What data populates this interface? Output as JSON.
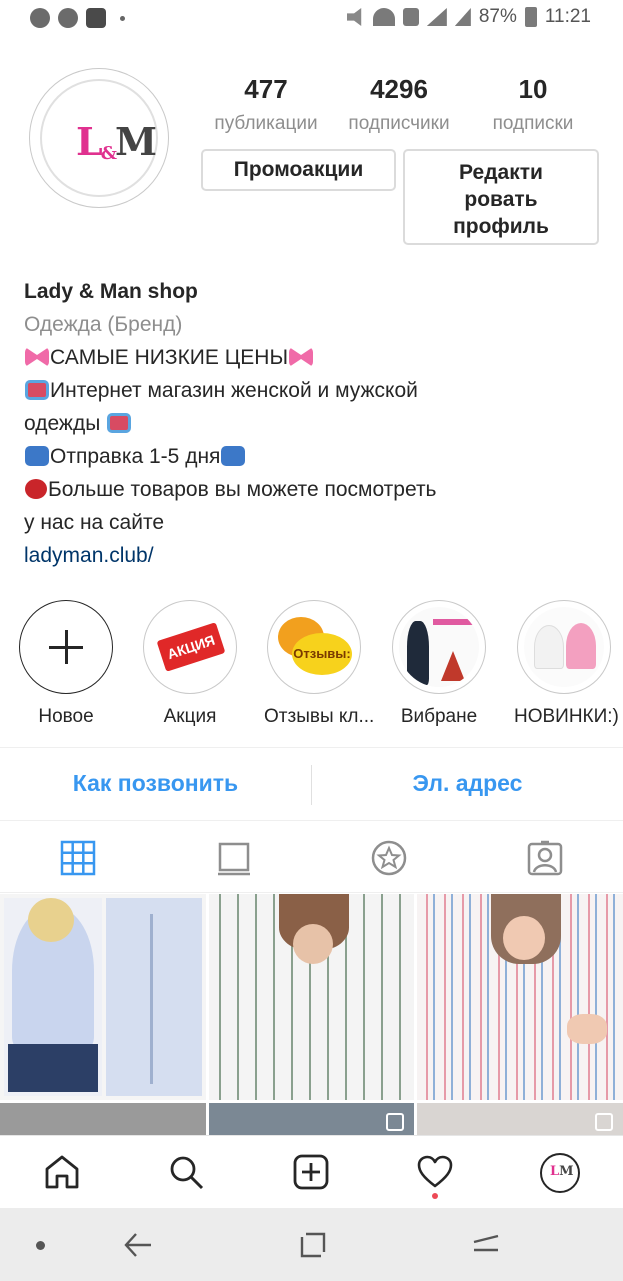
{
  "status_bar": {
    "battery": "87%",
    "time": "11:21",
    "icons": [
      "whatsapp-icon",
      "telegram-icon",
      "android-icon",
      "mute-icon",
      "wifi-icon",
      "nfc-icon",
      "signal-icon",
      "signal-icon",
      "battery-icon"
    ]
  },
  "profile": {
    "logo_text": {
      "l": "L",
      "amp": "&",
      "m": "M"
    },
    "stats": [
      {
        "value": "477",
        "label": "публикации"
      },
      {
        "value": "4296",
        "label": "подписчики"
      },
      {
        "value": "10",
        "label": "подписки"
      }
    ],
    "promo_button": "Промоакции",
    "edit_button_lines": [
      "Редакти",
      "ровать",
      "профиль"
    ]
  },
  "bio": {
    "name": "Lady & Man shop",
    "category": "Одежда (Бренд)",
    "line1": "САМЫЕ НИЗКИЕ ЦЕНЫ",
    "line2a": "Интернет магазин женской  и мужской",
    "line2b": "одежды ",
    "line3": "Отправка 1-5 дня",
    "line4a": "Больше товаров вы можете посмотреть",
    "line4b": "у нас на сайте",
    "link": "ladyman.club/"
  },
  "highlights": [
    {
      "label": "Новое"
    },
    {
      "label": "Акция",
      "badge": "АКЦИЯ"
    },
    {
      "label": "Отзывы кл...",
      "badge": "Отзывы:"
    },
    {
      "label": "Вибране"
    },
    {
      "label": "НОВИНКИ:)"
    }
  ],
  "contact": {
    "call": "Как позвонить",
    "email": "Эл. адрес"
  },
  "tabs": [
    "grid-icon",
    "igtv-icon",
    "star-icon",
    "tagged-icon"
  ],
  "bottom_nav": [
    "home-icon",
    "search-icon",
    "add-post-icon",
    "activity-heart-icon",
    "profile-avatar-icon"
  ],
  "colors": {
    "accent_blue": "#3897f0",
    "link_blue": "#003569",
    "brand_pink": "#e0318f",
    "muted_text": "#8e8e8e"
  }
}
